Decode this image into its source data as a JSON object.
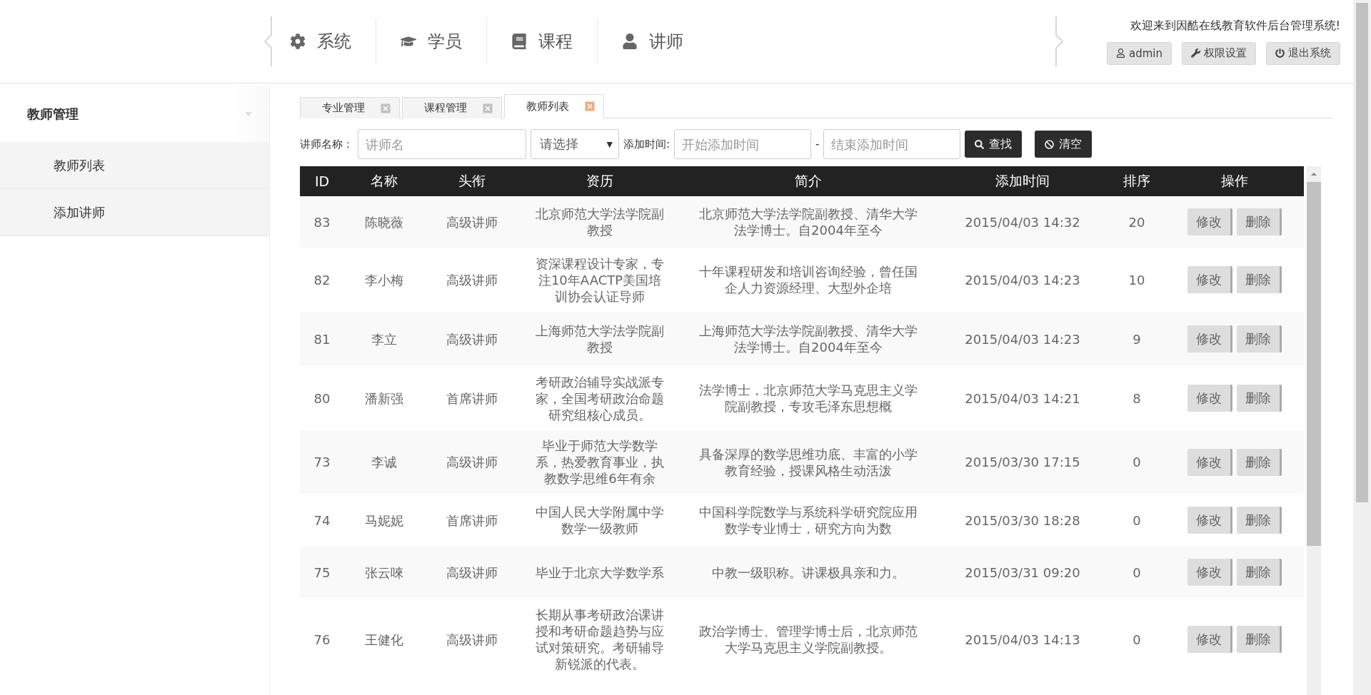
{
  "header": {
    "nav": [
      "系统",
      "学员",
      "课程",
      "讲师"
    ],
    "welcome": "欢迎来到因酷在线教育软件后台管理系统!",
    "buttons": [
      "admin",
      "权限设置",
      "退出系统"
    ]
  },
  "sidebar": {
    "title": "教师管理",
    "items": [
      "教师列表",
      "添加讲师"
    ]
  },
  "tabs": [
    {
      "label": "专业管理",
      "selected": false
    },
    {
      "label": "课程管理",
      "selected": false
    },
    {
      "label": "教师列表",
      "selected": true
    }
  ],
  "filter": {
    "name_label": "讲师名称：",
    "name_placeholder": "讲师名",
    "select": "请选择",
    "select_arrow": "▼",
    "time_label": "添加时间:",
    "start_placeholder": "开始添加时间",
    "dash": "-",
    "end_placeholder": "结束添加时间",
    "search": "查找",
    "clear": "清空"
  },
  "table": {
    "columns": [
      "ID",
      "名称",
      "头衔",
      "资历",
      "简介",
      "添加时间",
      "排序",
      "操作"
    ],
    "rows": [
      {
        "id": "83",
        "name": "陈晓薇",
        "title": "高级讲师",
        "background": "北京师范大学法学院副教授",
        "intro": "北京师范大学法学院副教授、清华大学法学博士。自2004年至今",
        "added": "2015/04/03 14:32",
        "order": "20",
        "actions": [
          "修改",
          "删除"
        ]
      },
      {
        "id": "82",
        "name": "李小梅",
        "title": "高级讲师",
        "background": "资深课程设计专家，专注10年AACTP美国培训协会认证导师",
        "intro": "十年课程研发和培训咨询经验，曾任国企人力资源经理、大型外企培",
        "added": "2015/04/03 14:23",
        "order": "10",
        "actions": [
          "修改",
          "删除"
        ]
      },
      {
        "id": "81",
        "name": "李立",
        "title": "高级讲师",
        "background": "上海师范大学法学院副教授",
        "intro": "上海师范大学法学院副教授、清华大学法学博士。自2004年至今",
        "added": "2015/04/03 14:23",
        "order": "9",
        "actions": [
          "修改",
          "删除"
        ]
      },
      {
        "id": "80",
        "name": "潘新强",
        "title": "首席讲师",
        "background": "考研政治辅导实战派专家，全国考研政治命题研究组核心成员。",
        "intro": "法学博士，北京师范大学马克思主义学院副教授，专攻毛泽东思想概",
        "added": "2015/04/03 14:21",
        "order": "8",
        "actions": [
          "修改",
          "删除"
        ]
      },
      {
        "id": "73",
        "name": "李诚",
        "title": "高级讲师",
        "background": "毕业于师范大学数学系，热爱教育事业，执教数学思维6年有余",
        "intro": "具备深厚的数学思维功底、丰富的小学教育经验，授课风格生动活泼",
        "added": "2015/03/30 17:15",
        "order": "0",
        "actions": [
          "修改",
          "删除"
        ]
      },
      {
        "id": "74",
        "name": "马妮妮",
        "title": "首席讲师",
        "background": "中国人民大学附属中学数学一级教师",
        "intro": "中国科学院数学与系统科学研究院应用数学专业博士，研究方向为数",
        "added": "2015/03/30 18:28",
        "order": "0",
        "actions": [
          "修改",
          "删除"
        ]
      },
      {
        "id": "75",
        "name": "张云唻",
        "title": "高级讲师",
        "background": "毕业于北京大学数学系",
        "intro": "中教一级职称。讲课极具亲和力。",
        "added": "2015/03/31 09:20",
        "order": "0",
        "actions": [
          "修改",
          "删除"
        ]
      },
      {
        "id": "76",
        "name": "王健化",
        "title": "高级讲师",
        "background": "长期从事考研政治课讲授和考研命题趋势与应试对策研究。考研辅导新锐派的代表。",
        "intro": "政治学博士、管理学博士后，北京师范大学马克思主义学院副教授。",
        "added": "2015/04/03 14:13",
        "order": "0",
        "actions": [
          "修改",
          "删除"
        ]
      }
    ]
  }
}
